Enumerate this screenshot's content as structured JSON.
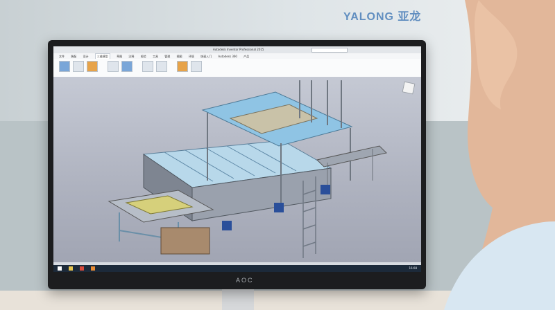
{
  "colors": {
    "wall": "#dfe5e8",
    "monitor_bezel": "#1c1d1f",
    "viewport_bg": "#aeb2bf",
    "machine_blue": "#7fb6d9",
    "machine_gray": "#8d929d",
    "accent_blue": "#2a4f9a",
    "roller_yellow": "#d8d06a",
    "skin": "#e2b79a",
    "shirt": "#d8e7f2"
  },
  "screen": {
    "app_title": "Autodesk Inventor Professional 2015",
    "menu_items": [
      "文件",
      "装配",
      "设计",
      "三维模型",
      "草图",
      "注释",
      "检验",
      "工具",
      "管理",
      "视图",
      "环境",
      "快速入门",
      "Autodesk 360",
      "产品"
    ],
    "active_menu": "三维模型",
    "taskbar_time": "16:08"
  },
  "signage": {
    "wall_sign": "YALONG 亚龙",
    "monitor_brand": "AOC"
  },
  "icons": [
    "windows-start-icon",
    "file-explorer-icon",
    "autodesk-inventor-icon",
    "app-icon"
  ]
}
